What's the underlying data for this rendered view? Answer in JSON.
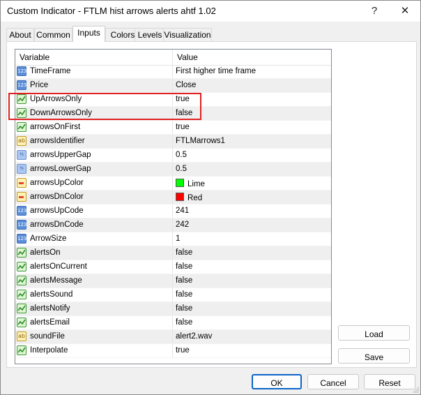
{
  "window": {
    "title": "Custom Indicator - FTLM hist arrows alerts ahtf 1.02",
    "help_glyph": "?",
    "close_glyph": "✕"
  },
  "tabs": [
    "About",
    "Common",
    "Inputs",
    "Colors",
    "Levels",
    "Visualization"
  ],
  "active_tab": "Inputs",
  "grid": {
    "col_variable": "Variable",
    "col_value": "Value",
    "rows": [
      {
        "icon": "integer-icon",
        "name": "TimeFrame",
        "value": "First higher time frame"
      },
      {
        "icon": "integer-icon",
        "name": "Price",
        "value": "Close"
      },
      {
        "icon": "boolean-icon",
        "name": "UpArrowsOnly",
        "value": "true"
      },
      {
        "icon": "boolean-icon",
        "name": "DownArrowsOnly",
        "value": "false"
      },
      {
        "icon": "boolean-icon",
        "name": "arrowsOnFirst",
        "value": "true"
      },
      {
        "icon": "string-icon",
        "name": "arrowsIdentifier",
        "value": "FTLMarrows1"
      },
      {
        "icon": "double-icon",
        "name": "arrowsUpperGap",
        "value": "0.5"
      },
      {
        "icon": "double-icon",
        "name": "arrowsLowerGap",
        "value": "0.5"
      },
      {
        "icon": "color-icon",
        "name": "arrowsUpColor",
        "value": "Lime",
        "swatch": "#00ff00"
      },
      {
        "icon": "color-icon",
        "name": "arrowsDnColor",
        "value": "Red",
        "swatch": "#ff0000"
      },
      {
        "icon": "integer-icon",
        "name": "arrowsUpCode",
        "value": "241"
      },
      {
        "icon": "integer-icon",
        "name": "arrowsDnCode",
        "value": "242"
      },
      {
        "icon": "integer-icon",
        "name": "ArrowSize",
        "value": "1"
      },
      {
        "icon": "boolean-icon",
        "name": "alertsOn",
        "value": "false"
      },
      {
        "icon": "boolean-icon",
        "name": "alertsOnCurrent",
        "value": "false"
      },
      {
        "icon": "boolean-icon",
        "name": "alertsMessage",
        "value": "false"
      },
      {
        "icon": "boolean-icon",
        "name": "alertsSound",
        "value": "false"
      },
      {
        "icon": "boolean-icon",
        "name": "alertsNotify",
        "value": "false"
      },
      {
        "icon": "boolean-icon",
        "name": "alertsEmail",
        "value": "false"
      },
      {
        "icon": "string-icon",
        "name": "soundFile",
        "value": "alert2.wav"
      },
      {
        "icon": "boolean-icon",
        "name": "Interpolate",
        "value": "true"
      }
    ]
  },
  "side_buttons": {
    "load": "Load",
    "save": "Save"
  },
  "footer_buttons": {
    "ok": "OK",
    "cancel": "Cancel",
    "reset": "Reset"
  },
  "colors": {
    "highlight": "#e12020",
    "primary_border": "#0a64c8"
  }
}
